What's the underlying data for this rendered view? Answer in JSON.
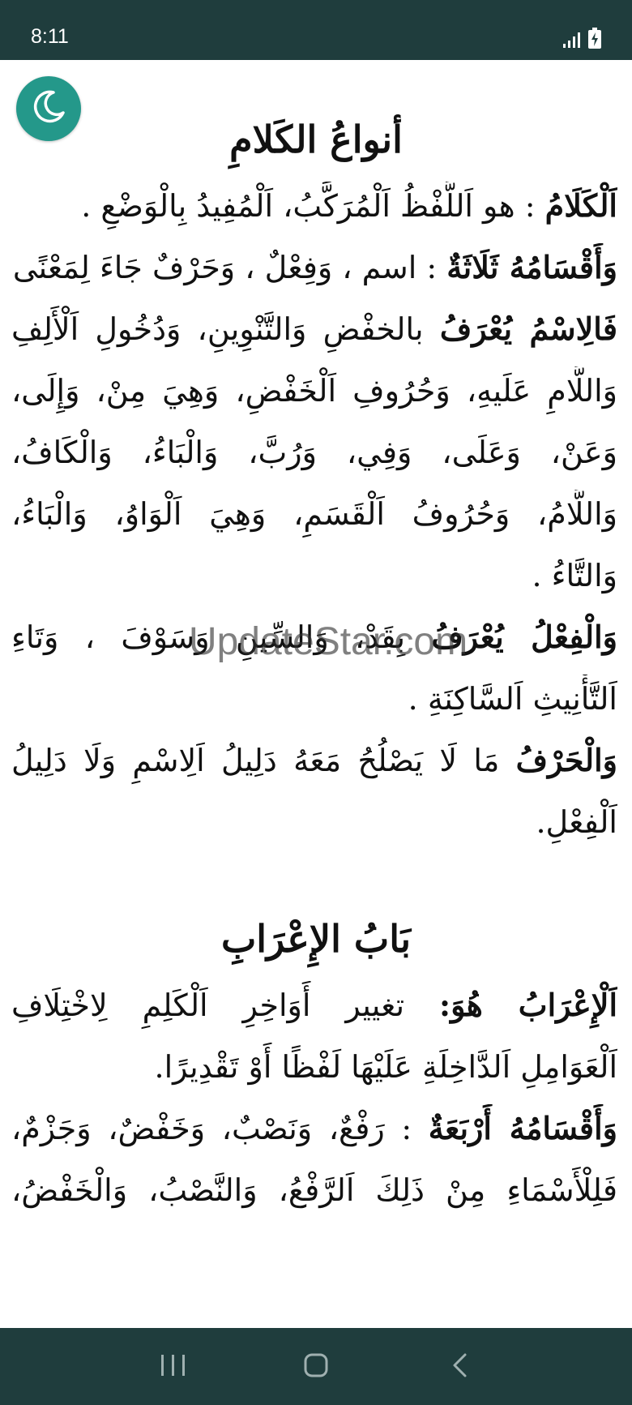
{
  "status_bar": {
    "time": "8:11",
    "icons": [
      "signal-icon",
      "battery-charging-icon"
    ]
  },
  "night_mode_icon": "moon-icon",
  "colors": {
    "bar_background": "#1f3d3d",
    "fab_background": "#24988a",
    "text": "#111111"
  },
  "section1": {
    "title": "أنواعُ الكَلامِ",
    "lines": [
      {
        "bold": "اَلْكَلَامُ",
        "rest": " : هو اَللَّفْظُ اَلْمُرَكَّبُ، اَلْمُفِيدُ بِالْوَضْعِ ."
      },
      {
        "bold": "وَأَقْسَامُهُ ثَلَاثَةٌ",
        "rest": " : اسم ، وَفِعْلٌ ، وَحَرْفٌ جَاءَ لِمَعْنًى."
      },
      {
        "bold": "فَالِاسْمُ يُعْرَفُ",
        "rest": " بالخفْضِ وَالتَّنْوِينِ، وَدُخُولِ اَلْأَلِفِ"
      },
      {
        "bold": "",
        "rest": "وَاللَّامِ عَلَيهِ، وَحُرُوفِ اَلْخَفْضِ، وَهِيَ مِنْ، وَإِلَى،"
      },
      {
        "bold": "",
        "rest": "وَعَنْ، وَعَلَى، وَفِي، وَرُبَّ، وَالْبَاءُ، وَالْكَافُ،"
      },
      {
        "bold": "",
        "rest": "وَاللَّامُ، وَحُرُوفُ اَلْقَسَمِ، وَهِيَ اَلْوَاوُ، وَالْبَاءُ،"
      },
      {
        "bold": "",
        "rest": "وَالتَّاءُ ."
      },
      {
        "bold": "وَالْفِعْلُ يُعْرَفُ",
        "rest": " بِقَدْ، وَالسِّينِ وَسَوْفَ ، وَتَاءِ"
      },
      {
        "bold": "",
        "rest": "اَلتَّأْنِيثِ اَلسَّاكِنَةِ ."
      },
      {
        "bold": "وَالْحَرْفُ",
        "rest": " مَا لَا يَصْلُحُ مَعَهُ دَلِيلُ اَلِاسْمِ وَلَا دَلِيلُ"
      },
      {
        "bold": "",
        "rest": "اَلْفِعْلِ."
      }
    ]
  },
  "section2": {
    "title": "بَابُ الإِعْرَابِ",
    "lines": [
      {
        "bold": "اَلْإِعْرَابُ هُوَ:",
        "rest": " تغيير أَوَاخِرِ اَلْكَلِمِ لِاخْتِلَافِ"
      },
      {
        "bold": "",
        "rest": "اَلْعَوَامِلِ اَلدَّاخِلَةِ عَلَيْهَا لَفْظًا أَوْ تَقْدِيرًا."
      },
      {
        "bold": "وَأَقْسَامُهُ أَرْبَعَةٌ",
        "rest": " : رَفْعٌ، وَنَصْبٌ، وَخَفْضٌ، وَجَزْمٌ،"
      },
      {
        "bold": "",
        "rest": "فَلِلْأَسْمَاءِ مِنْ ذَلِكَ اَلرَّفْعُ، وَالنَّصْبُ، وَالْخَفْضُ،"
      }
    ]
  },
  "watermark": "UpdateStar.com",
  "nav_bar": {
    "buttons": [
      "recent-apps-icon",
      "home-icon",
      "back-icon"
    ]
  }
}
